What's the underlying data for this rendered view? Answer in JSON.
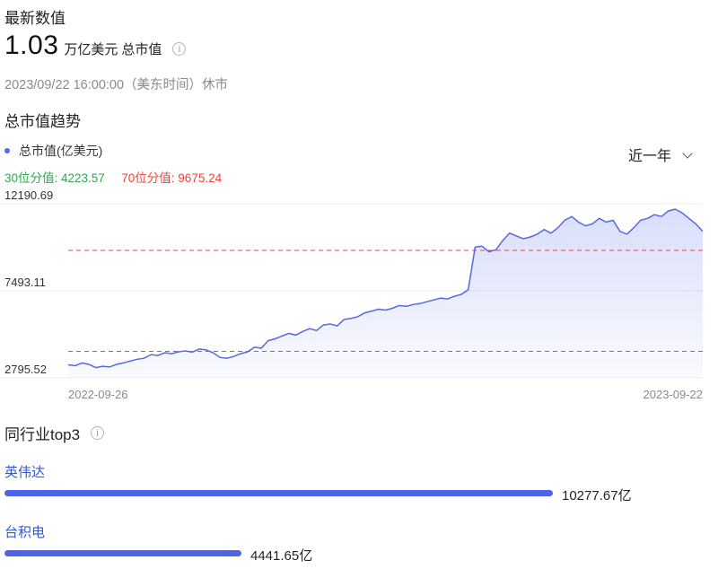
{
  "header": {
    "section_title": "最新数值",
    "value": "1.03",
    "unit": "万亿美元",
    "metric_label": "总市值",
    "info_icon": "info-icon",
    "timestamp": "2023/09/22 16:00:00（美东时间）休市"
  },
  "trend": {
    "title": "总市值趋势",
    "legend_label": "总市值(亿美元)",
    "legend_color": "#5468e8",
    "p30_label": "30位分值: 4223.57",
    "p70_label": "70位分值: 9675.24",
    "p30_color": "#2ea84f",
    "p70_color": "#e8453c",
    "range_selector": "近一年",
    "range_icon": "chevron-down-icon"
  },
  "chart_data": {
    "type": "area",
    "ylabel": "",
    "xlabel": "",
    "ylim": [
      2795.52,
      12190.69
    ],
    "y_ticks": [
      "12190.69",
      "7493.11",
      "2795.52"
    ],
    "x_ticks": [
      "2022-09-26",
      "2023-09-22"
    ],
    "grid": true,
    "reference_lines": [
      {
        "name": "30位分值",
        "value": 4223.57,
        "color": "#2ea84f",
        "style": "dashed"
      },
      {
        "name": "70位分值",
        "value": 9675.24,
        "color": "#e8453c",
        "style": "dashed"
      }
    ],
    "series": [
      {
        "name": "总市值(亿美元)",
        "color": "#5468e8",
        "values": [
          3500,
          3450,
          3600,
          3520,
          3350,
          3420,
          3380,
          3520,
          3600,
          3700,
          3800,
          3850,
          4050,
          4000,
          4150,
          4100,
          4200,
          4250,
          4180,
          4350,
          4300,
          4150,
          3900,
          3850,
          3950,
          4100,
          4200,
          4450,
          4400,
          4800,
          4900,
          5050,
          5200,
          5100,
          5300,
          5450,
          5350,
          5650,
          5700,
          5600,
          5950,
          6000,
          6100,
          6300,
          6400,
          6500,
          6450,
          6550,
          6700,
          6650,
          6750,
          6800,
          6900,
          7000,
          7100,
          7050,
          7200,
          7300,
          7550,
          9850,
          9900,
          9600,
          9700,
          10200,
          10600,
          10450,
          10300,
          10400,
          10550,
          10800,
          10600,
          10900,
          11300,
          11500,
          11200,
          11000,
          11100,
          11400,
          11200,
          11300,
          10700,
          10550,
          10900,
          11300,
          11400,
          11600,
          11500,
          11800,
          11900,
          11700,
          11400,
          11100,
          10700
        ]
      }
    ]
  },
  "peers": {
    "title": "同行业top3",
    "info_icon": "info-icon",
    "bar_color": "#4f63ea",
    "items": [
      {
        "name": "英伟达",
        "value_label": "10277.67亿",
        "value": 10277.67
      },
      {
        "name": "台积电",
        "value_label": "4441.65亿",
        "value": 4441.65
      }
    ]
  }
}
